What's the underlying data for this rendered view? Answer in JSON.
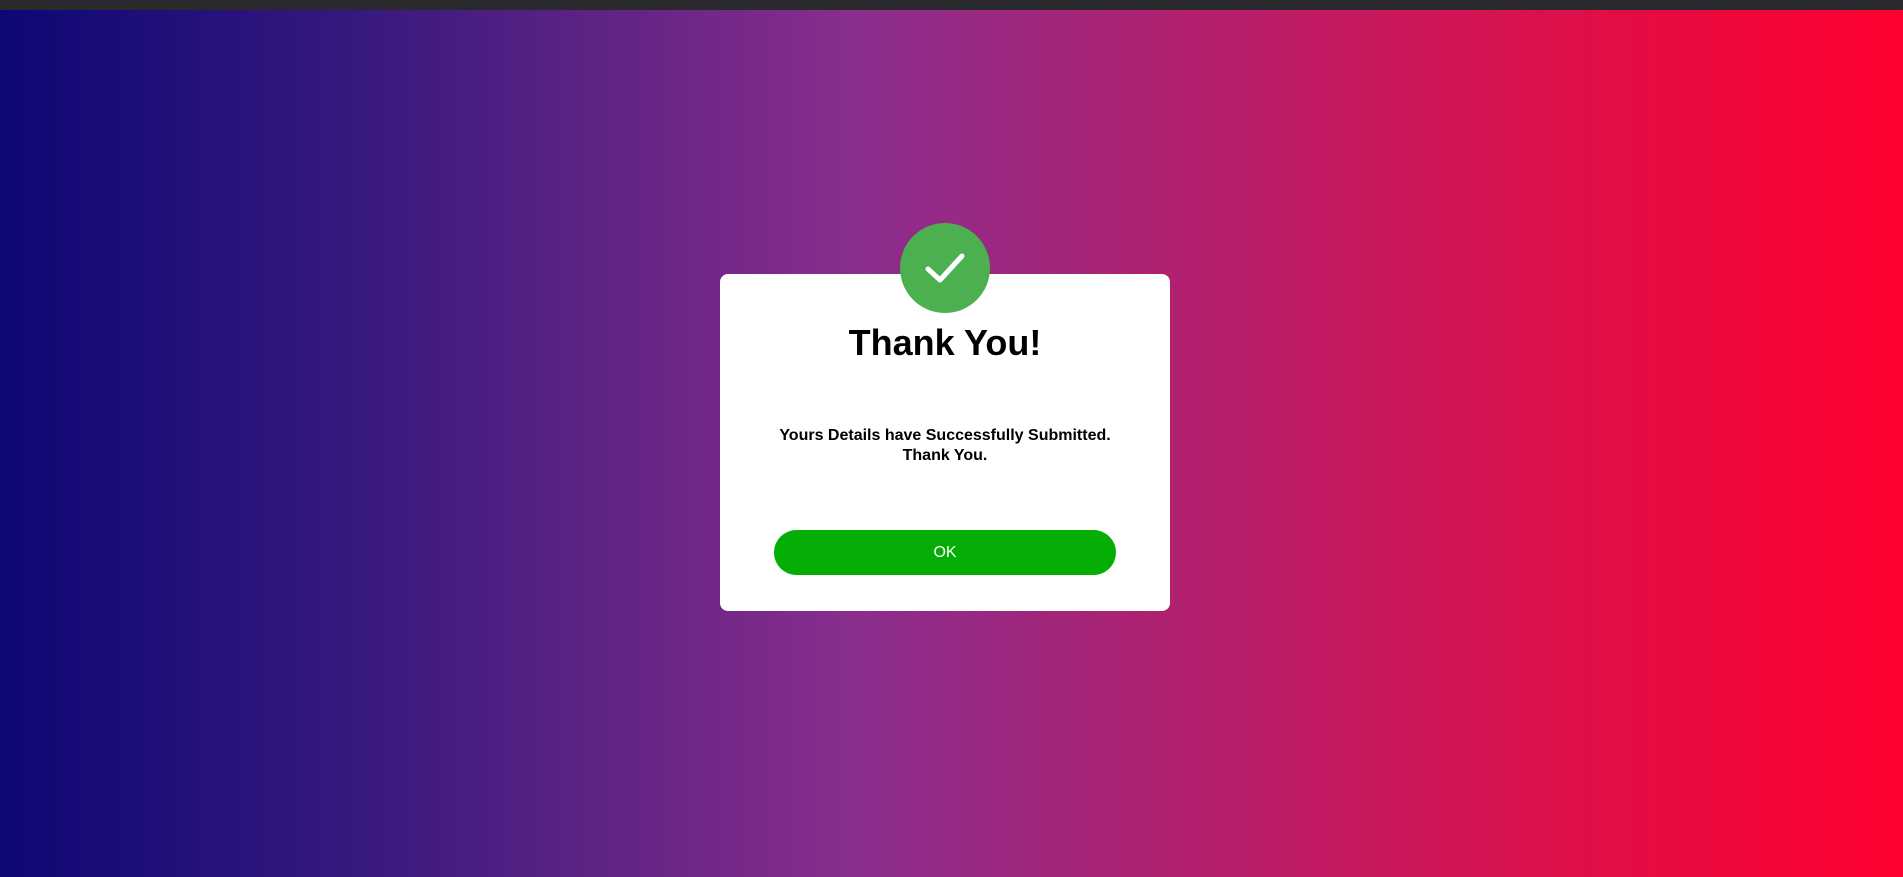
{
  "dialog": {
    "title": "Thank You!",
    "message_line1": "Yours Details have Successfully Submitted.",
    "message_line2": "Thank You.",
    "ok_label": "OK",
    "status_icon": "check-icon"
  },
  "colors": {
    "background_gradient_start": "#0d0775",
    "background_gradient_mid": "#8a2e8d",
    "background_gradient_end": "#ff0030",
    "success_circle": "#4caf50",
    "ok_button": "#05ae05",
    "modal_background": "#ffffff"
  }
}
